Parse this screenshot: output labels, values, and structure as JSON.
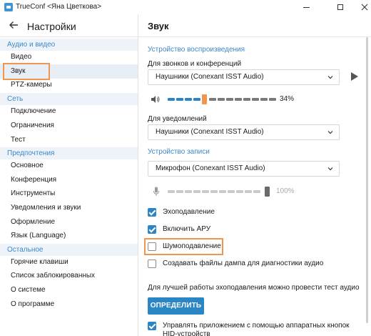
{
  "window": {
    "title": "TrueConf <Яна Цветкова>"
  },
  "sidebar": {
    "title": "Настройки",
    "groups": [
      {
        "header": "Аудио и видео",
        "items": [
          "Видео",
          "Звук",
          "PTZ-камеры"
        ]
      },
      {
        "header": "Сеть",
        "items": [
          "Подключение",
          "Ограничения",
          "Тест"
        ]
      },
      {
        "header": "Предпочтения",
        "items": [
          "Основное",
          "Конференция",
          "Инструменты",
          "Уведомления и звуки",
          "Оформление",
          "Язык (Language)"
        ]
      },
      {
        "header": "Остальное",
        "items": [
          "Горячие клавиши",
          "Список заблокированных",
          "О системе",
          "О программе"
        ]
      }
    ],
    "selected": "Звук"
  },
  "content": {
    "title": "Звук",
    "playback": {
      "section": "Устройство воспроизведения",
      "calls_label": "Для звонков и конференций",
      "calls_device": "Наушники (Conexant ISST Audio)",
      "volume_value": "34%",
      "volume_level": 0.34,
      "notify_label": "Для уведомлений",
      "notify_device": "Наушники (Conexant ISST Audio)"
    },
    "recording": {
      "section": "Устройство записи",
      "device": "Микрофон (Conexant ISST Audio)",
      "level_value": "100%",
      "level": 1.0
    },
    "options": {
      "echo_cancel": {
        "label": "Эхоподавление",
        "checked": true
      },
      "agc": {
        "label": "Включить АРУ",
        "checked": true
      },
      "noise_suppress": {
        "label": "Шумоподавление",
        "checked": false
      },
      "dump_files": {
        "label": "Создавать файлы дампа для диагностики аудио",
        "checked": false
      }
    },
    "test_note": "Для лучшей работы эхоподавления можно провести тест аудио",
    "test_button": "ОПРЕДЕЛИТЬ",
    "hid_option": {
      "label": "Управлять приложением с помощью аппаратных кнопок HID-устройств",
      "checked": true
    }
  },
  "colors": {
    "accent": "#2b86c5",
    "group_header_bg": "#eef3fa",
    "highlight": "#f0964f"
  }
}
